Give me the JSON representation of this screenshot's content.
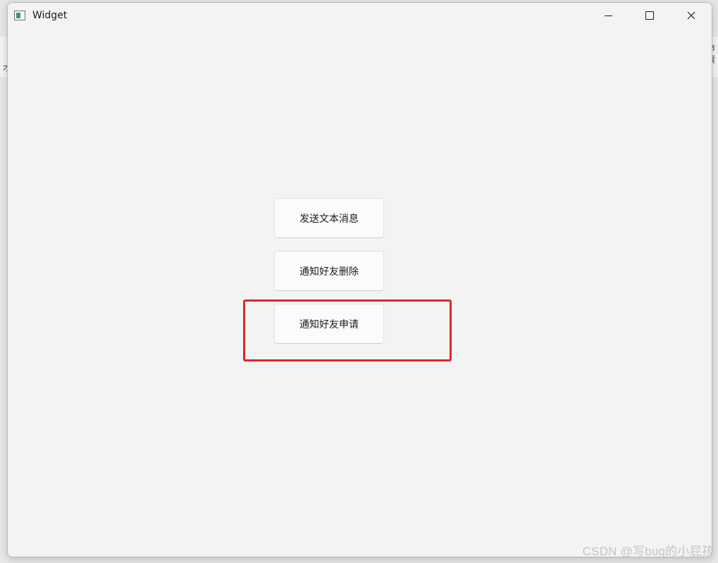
{
  "window": {
    "title": "Widget",
    "icon": "app-window-icon"
  },
  "caption_buttons": {
    "minimize_icon": "minimize-icon",
    "maximize_icon": "maximize-icon",
    "close_icon": "close-icon"
  },
  "buttons": [
    {
      "label": "发送文本消息"
    },
    {
      "label": "通知好友删除"
    },
    {
      "label": "通知好友申请"
    }
  ],
  "highlight": {
    "color": "#e0262a",
    "target_label": "通知好友申请"
  },
  "watermark": {
    "text": "CSDN @写bug的小屁孩"
  },
  "background_app": {
    "right_glyph_top": "命",
    "right_glyph_bottom": "票",
    "left_glyph": "才"
  }
}
